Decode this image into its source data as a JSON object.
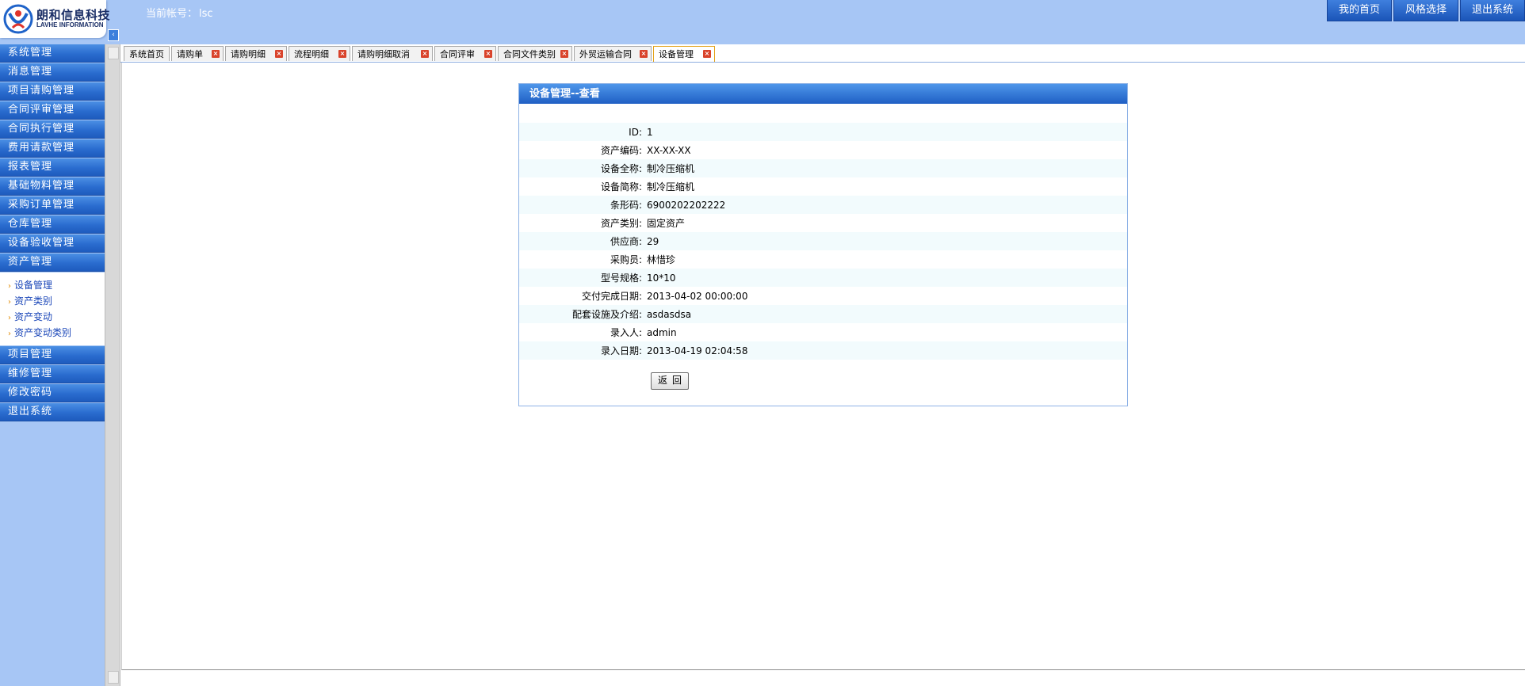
{
  "header": {
    "logo_cn": "朗和信息科技",
    "logo_en": "LAVHE INFORMATION",
    "account_label": "当前帐号：",
    "account_value": "lsc",
    "buttons": [
      {
        "label": "我的首页"
      },
      {
        "label": "风格选择"
      },
      {
        "label": "退出系统"
      }
    ]
  },
  "sidebar": {
    "menu_top": [
      {
        "label": "系统管理"
      },
      {
        "label": "消息管理"
      },
      {
        "label": "项目请购管理"
      },
      {
        "label": "合同评审管理"
      },
      {
        "label": "合同执行管理"
      },
      {
        "label": "费用请款管理"
      },
      {
        "label": "报表管理"
      },
      {
        "label": "基础物料管理"
      },
      {
        "label": "采购订单管理"
      },
      {
        "label": "仓库管理"
      },
      {
        "label": "设备验收管理"
      },
      {
        "label": "资产管理"
      }
    ],
    "submenu": [
      {
        "label": "设备管理"
      },
      {
        "label": "资产类别"
      },
      {
        "label": "资产变动"
      },
      {
        "label": "资产变动类别"
      }
    ],
    "menu_bottom": [
      {
        "label": "项目管理"
      },
      {
        "label": "维修管理"
      },
      {
        "label": "修改密码"
      },
      {
        "label": "退出系统"
      }
    ]
  },
  "tabs": [
    {
      "label": "系统首页"
    },
    {
      "label": "请购单"
    },
    {
      "label": "请购明细"
    },
    {
      "label": "流程明细"
    },
    {
      "label": "请购明细取消"
    },
    {
      "label": "合同评审"
    },
    {
      "label": "合同文件类别"
    },
    {
      "label": "外贸运输合同"
    },
    {
      "label": "设备管理"
    }
  ],
  "panel": {
    "title": "设备管理--查看",
    "fields": [
      {
        "label": "ID:",
        "value": "1"
      },
      {
        "label": "资产编码:",
        "value": "XX-XX-XX"
      },
      {
        "label": "设备全称:",
        "value": "制冷压缩机"
      },
      {
        "label": "设备简称:",
        "value": "制冷压缩机"
      },
      {
        "label": "条形码:",
        "value": "6900202202222"
      },
      {
        "label": "资产类别:",
        "value": "固定资产"
      },
      {
        "label": "供应商:",
        "value": "29"
      },
      {
        "label": "采购员:",
        "value": "林惜珍"
      },
      {
        "label": "型号规格:",
        "value": "10*10"
      },
      {
        "label": "交付完成日期:",
        "value": "2013-04-02 00:00:00"
      },
      {
        "label": "配套设施及介绍:",
        "value": "asdasdsa"
      },
      {
        "label": "录入人:",
        "value": "admin"
      },
      {
        "label": "录入日期:",
        "value": "2013-04-19 02:04:58"
      }
    ],
    "back_label": "返回"
  },
  "colors": {
    "header_bg": "#a7c6f5",
    "menu_blue": "#2a6ccf",
    "active_tab_border": "#e3a21a",
    "close_red": "#d9432b"
  }
}
